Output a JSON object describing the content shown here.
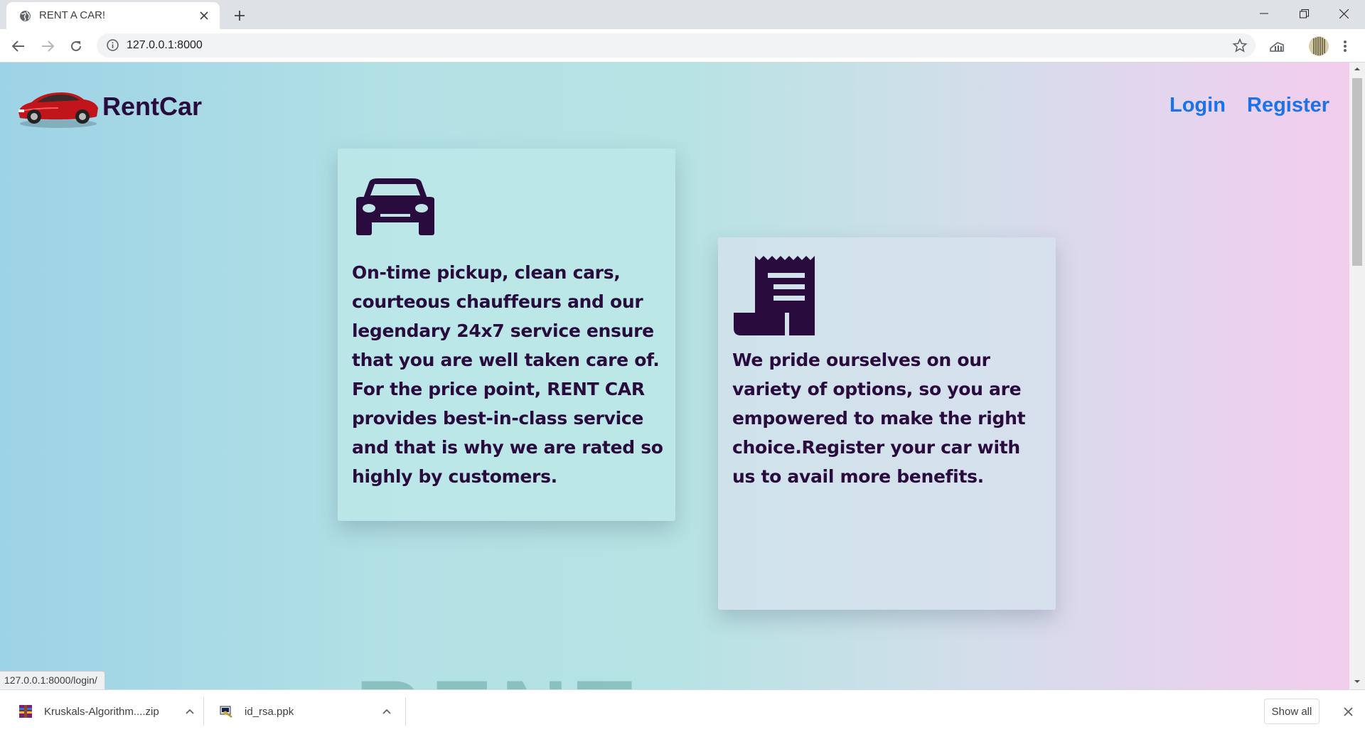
{
  "browser": {
    "tab_title": "RENT A CAR!",
    "url": "127.0.0.1:8000",
    "status_url": "127.0.0.1:8000/login/"
  },
  "site": {
    "brand": "RentCar",
    "nav": {
      "login": "Login",
      "register": "Register"
    },
    "cards": [
      {
        "icon": "car-icon",
        "text": "On-time pickup, clean cars, courteous chauffeurs and our legendary 24x7 service ensure that you are well taken care of. For the price point, RENT CAR provides best-in-class service and that is why we are rated so highly by customers."
      },
      {
        "icon": "receipt-icon",
        "text": "We pride ourselves on our variety of options, so you are empowered to make the right choice.Register your car with us to avail more benefits."
      }
    ],
    "big_word": "RENT"
  },
  "downloads": {
    "items": [
      {
        "name": "Kruskals-Algorithm....zip",
        "icon": "winrar-archive-icon"
      },
      {
        "name": "id_rsa.ppk",
        "icon": "putty-key-icon"
      }
    ],
    "show_all": "Show all"
  },
  "colors": {
    "text_dark": "#2a0b3e",
    "link_blue": "#1a73e8",
    "gradient_start": "#9dd3e6",
    "gradient_end": "#f3cdee"
  }
}
